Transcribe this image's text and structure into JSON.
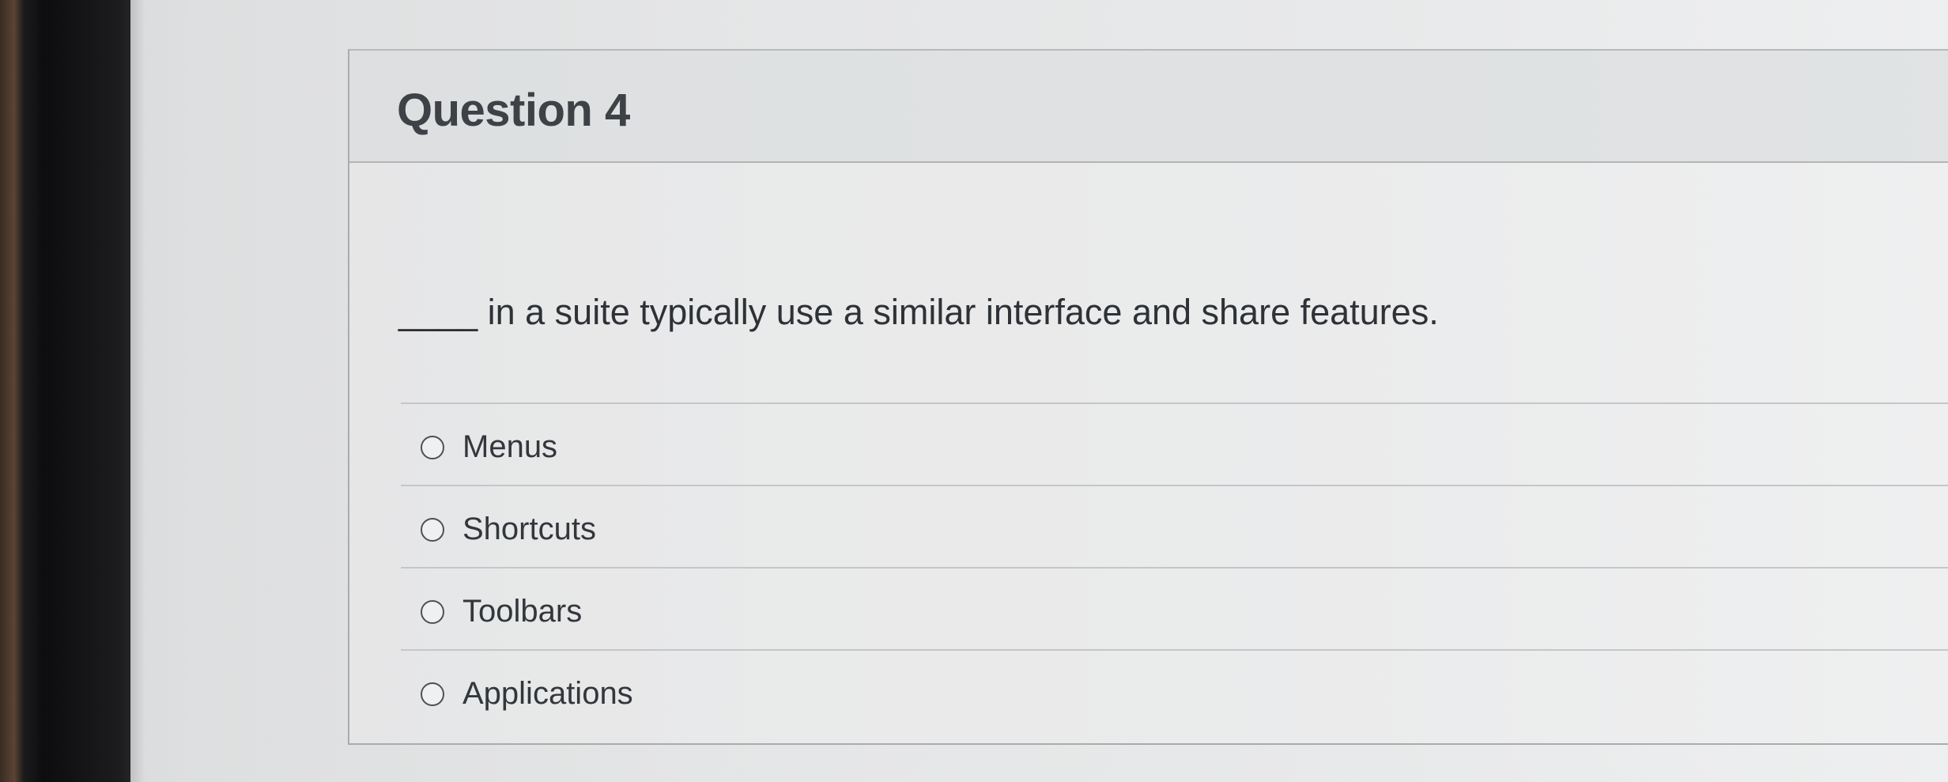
{
  "question": {
    "title": "Question 4",
    "prompt": "____ in a suite typically use a similar interface and share features.",
    "answers": [
      {
        "label": "Menus",
        "selected": false
      },
      {
        "label": "Shortcuts",
        "selected": false
      },
      {
        "label": "Toolbars",
        "selected": false
      },
      {
        "label": "Applications",
        "selected": false
      }
    ]
  },
  "colors": {
    "title_text": "#3e4247",
    "body_text": "#2e3237",
    "border": "#b2b4b6",
    "header_bg": "#d6d8da"
  }
}
